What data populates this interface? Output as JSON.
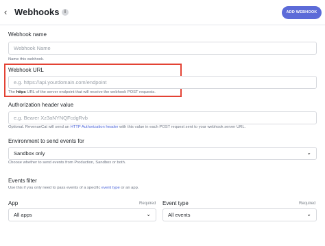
{
  "header": {
    "back_icon": "chevron-left-icon",
    "title": "Webhooks",
    "info_icon": "i",
    "add_button": "ADD WEBHOOK"
  },
  "webhook_name": {
    "label": "Webhook name",
    "placeholder": "Webhook Name",
    "help": "Name this webhook."
  },
  "webhook_url": {
    "label": "Webhook URL",
    "placeholder": "e.g. https://api.yourdomain.com/endpoint",
    "help_prefix": "The ",
    "help_bold": "https",
    "help_suffix": " URL of the server endpoint that will receive the webhook POST requests."
  },
  "auth_header": {
    "label": "Authorization header value",
    "placeholder": "e.g. Bearer Xz3aNYNQFcdgRvb",
    "help_prefix": "Optional. RevenueCat will send an ",
    "help_link": "HTTP Authorization header",
    "help_suffix": " with this value in each POST request sent to your webhook server URL."
  },
  "environment": {
    "label": "Environment to send events for",
    "selected": "Sandbox only",
    "help": "Choose whether to send events from Production, Sandbox or both."
  },
  "events_filter": {
    "title": "Events filter",
    "desc_prefix": "Use this if you only need to pass events of a specific ",
    "desc_link": "event type",
    "desc_suffix": " or an app."
  },
  "app": {
    "label": "App",
    "required": "Required",
    "selected": "All apps"
  },
  "event_type": {
    "label": "Event type",
    "required": "Required",
    "selected": "All events"
  },
  "colors": {
    "accent": "#5c6bd8",
    "highlight": "#e34234",
    "link": "#4a63d9"
  }
}
